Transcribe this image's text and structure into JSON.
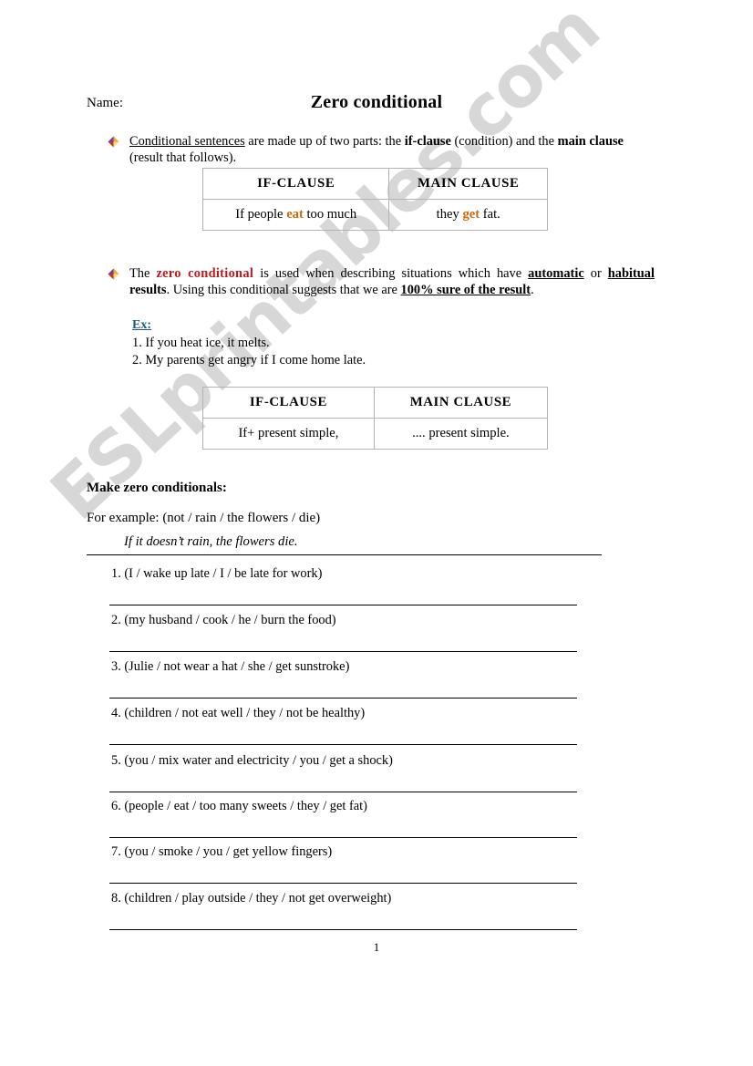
{
  "document": {
    "name_label": "Name:",
    "title": "Zero conditional",
    "page_number": "1"
  },
  "intro_bullet": {
    "icon": "diamond-bullet-icon",
    "part1_underlined": "Conditional sentences",
    "part2": " are made up of two parts: the ",
    "part3_bold": "if-clause",
    "part4": " (condition) and the ",
    "part5_bold": "main clause",
    "part6": " (result that follows)."
  },
  "table_example": {
    "headers": [
      "IF-CLAUSE",
      "MAIN CLAUSE"
    ],
    "row": {
      "if_clause_pre": "If people ",
      "if_clause_highlight": "eat",
      "if_clause_post": " too much",
      "main_clause_pre": "they ",
      "main_clause_highlight": "get",
      "main_clause_post": " fat."
    },
    "highlight_color": "#cd6a13"
  },
  "explain_bullet": {
    "icon": "diamond-bullet-icon",
    "part1": "The ",
    "part2_red": "zero conditional",
    "part3": " is used when describing situations which have ",
    "part4_bold_underline": "automatic",
    "part5": " or ",
    "part6_bold_underline": "habitual",
    "part7_bold": " results",
    "part8": ". Using this conditional suggests that we are ",
    "part9_bold_underline": "100% sure of the result",
    "part10": ".",
    "red_color": "#b81a22"
  },
  "examples": {
    "heading": "Ex:",
    "heading_color": "#1f5c7a",
    "items": [
      "1. If you heat ice, it melts.",
      "2. My parents get angry if I come home late."
    ]
  },
  "table_formula": {
    "headers": [
      "IF-CLAUSE",
      "MAIN CLAUSE"
    ],
    "row": [
      "If+ present simple,",
      ".... present simple."
    ]
  },
  "exercise": {
    "heading": "Make zero conditionals:",
    "for_example_label": "For example: (not / rain / the flowers / die)",
    "example_answer": "If it doesn’t rain, the flowers die.",
    "items": [
      "1. (I / wake up late / I / be late for work)",
      "2. (my husband / cook / he / burn the food)",
      "3. (Julie / not wear a hat / she / get sunstroke)",
      "4. (children / not eat well / they / not be healthy)",
      "5. (you / mix water and electricity / you / get a shock)",
      "6. (people / eat / too many sweets / they / get fat)",
      "7. (you / smoke / you / get yellow fingers)",
      "8. (children / play outside / they / not get overweight)"
    ]
  },
  "watermark": {
    "text": "ESLprintables.com"
  }
}
